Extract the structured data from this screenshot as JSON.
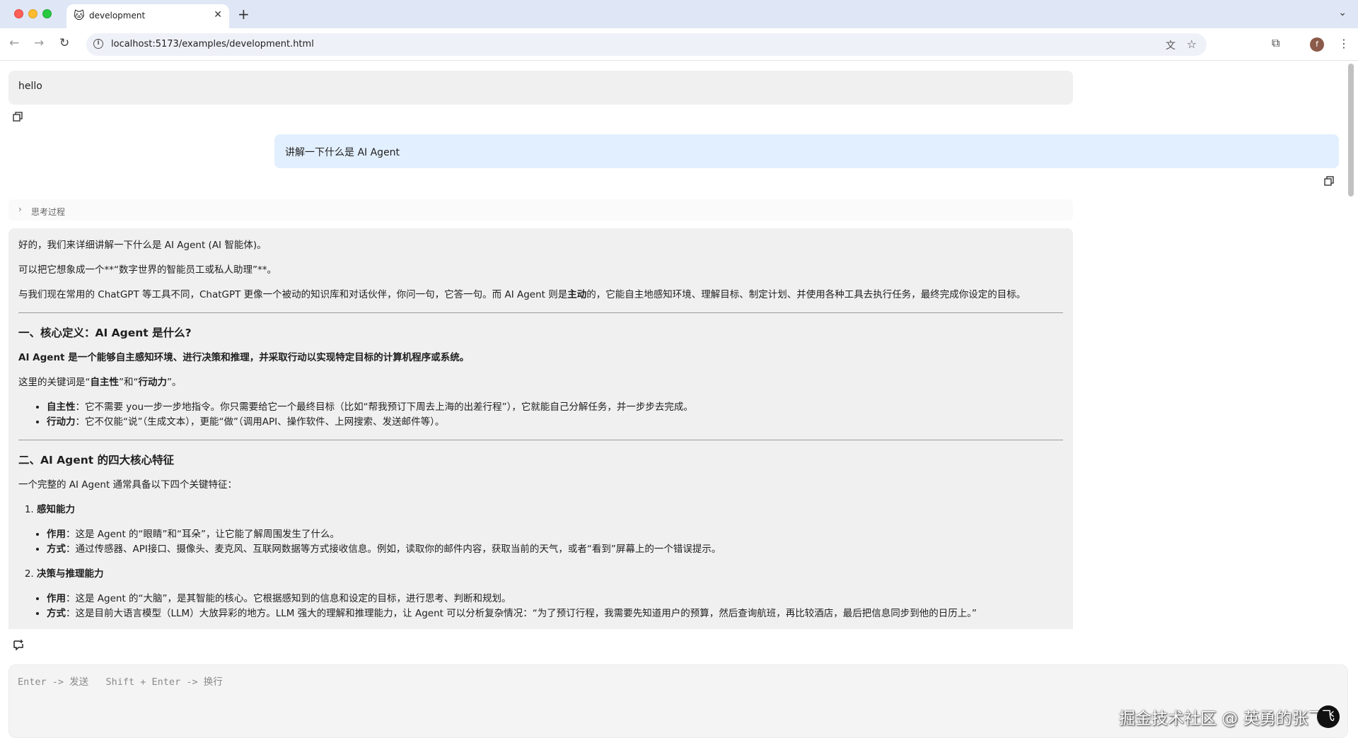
{
  "browser": {
    "tab_title": "development",
    "tab_favicon": "🐱",
    "url": "localhost:5173/examples/development.html",
    "profile_initial": "f"
  },
  "chat": {
    "message_1": "hello",
    "message_2": "讲解一下什么是 AI Agent",
    "thinking_label": "思考过程",
    "answer": {
      "intro_1": "好的，我们来详细讲解一下什么是 AI Agent (AI 智能体)。",
      "intro_2": "可以把它想象成一个**“数字世界的智能员工或私人助理”**。",
      "intro_3_a": "与我们现在常用的 ChatGPT 等工具不同，ChatGPT 更像一个被动的知识库和对话伙伴，你问一句，它答一句。而 AI Agent 则是",
      "intro_3_bold": "主动",
      "intro_3_b": "的，它能自主地感知环境、理解目标、制定计划、并使用各种工具去执行任务，最终完成你设定的目标。",
      "section_1_title": "一、核心定义：AI Agent 是什么?",
      "section_1_def": "AI Agent 是一个能够自主感知环境、进行决策和推理，并采取行动以实现特定目标的计算机程序或系统。",
      "keywords_a": "这里的关键词是“",
      "keywords_b1": "自主性",
      "keywords_mid": "”和“",
      "keywords_b2": "行动力",
      "keywords_end": "”。",
      "bullets": [
        {
          "term": "自主性",
          "text": "：它不需要 you一步一步地指令。你只需要给它一个最终目标（比如“帮我预订下周去上海的出差行程”），它就能自己分解任务，并一步步去完成。"
        },
        {
          "term": "行动力",
          "text": "：它不仅能“说”（生成文本），更能“做”（调用API、操作软件、上网搜索、发送邮件等）。"
        }
      ],
      "section_2_title": "二、AI Agent 的四大核心特征",
      "section_2_intro": "一个完整的 AI Agent 通常具备以下四个关键特征：",
      "features": [
        {
          "title": "感知能力",
          "items": [
            {
              "term": "作用",
              "text": "：这是 Agent 的“眼睛”和“耳朵”，让它能了解周围发生了什么。"
            },
            {
              "term": "方式",
              "text": "：通过传感器、API接口、摄像头、麦克风、互联网数据等方式接收信息。例如，读取你的邮件内容，获取当前的天气，或者“看到”屏幕上的一个错误提示。"
            }
          ]
        },
        {
          "title": "决策与推理能力",
          "items": [
            {
              "term": "作用",
              "text": "：这是 Agent 的“大脑”，是其智能的核心。它根据感知到的信息和设定的目标，进行思考、判断和规划。"
            },
            {
              "term": "方式",
              "text": "：这是目前大语言模型（LLM）大放异彩的地方。LLM 强大的理解和推理能力，让 Agent 可以分析复杂情况：“为了预订行程，我需要先知道用户的预算，然后查询航班，再比较酒店，最后把信息同步到他的日历上。”"
            }
          ]
        }
      ]
    },
    "input_placeholder": "Enter -> 发送   Shift + Enter -> 换行"
  },
  "watermark": "掘金技术社区 @ 英勇的张飞",
  "colors": {
    "user_bubble": "#e2effe",
    "assistant_bubble": "#f0f0f0",
    "tabbar": "#dfe6f5"
  }
}
